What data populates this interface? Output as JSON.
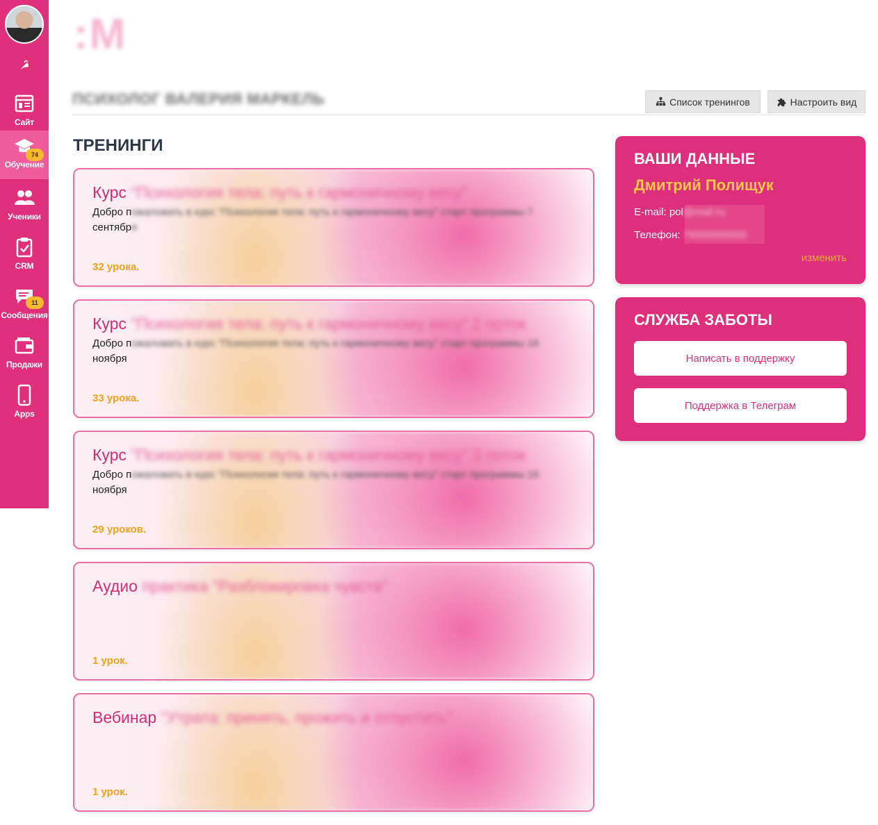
{
  "logo": ":M",
  "school_name": "ПСИХОЛОГ ВАЛЕРИЯ МАРКЕЛЬ",
  "sidebar": {
    "items": [
      {
        "label": "Сайт",
        "icon": "site-icon"
      },
      {
        "label": "Обучение",
        "icon": "graduation-cap-icon",
        "badge": "74"
      },
      {
        "label": "Ученики",
        "icon": "students-icon"
      },
      {
        "label": "CRM",
        "icon": "clipboard-check-icon"
      },
      {
        "label": "Сообщения",
        "icon": "chat-icon",
        "badge": "11"
      },
      {
        "label": "Продажи",
        "icon": "wallet-icon"
      },
      {
        "label": "Apps",
        "icon": "phone-icon"
      }
    ]
  },
  "toolbar": {
    "trainings_list_label": "Список тренингов",
    "customize_label": "Настроить вид"
  },
  "trainings": {
    "title": "ТРЕНИНГИ",
    "cards": [
      {
        "type": "Курс",
        "name": "\"Психология тела: путь к гармоничному весу\"",
        "desc_visible": "Добро п",
        "desc_blur": "ожаловать в курс \"Психология тела: путь к гармоничному весу\" старт программы 7",
        "desc_line2_visible": "сентябр",
        "desc_line2_blur": "я",
        "lessons": "32 урока."
      },
      {
        "type": "Курс",
        "name": "\"Психология тела: путь к гармоничному весу\" 2 поток",
        "desc_visible": "Добро п",
        "desc_blur": "ожаловать в курс \"Психология тела: путь к гармоничному весу\" старт программы 16",
        "desc_line2_visible": "ноября",
        "desc_line2_blur": "",
        "lessons": "33 урока."
      },
      {
        "type": "Курс",
        "name": "\"Психология тела: путь к гармоничному весу\" 3 поток",
        "desc_visible": "Добро п",
        "desc_blur": "ожаловать в курс \"Психология тела: путь к гармоничному весу\" старт программы 16",
        "desc_line2_visible": "ноября",
        "desc_line2_blur": "",
        "lessons": "29 уроков."
      },
      {
        "type": "Аудио",
        "name": "практика \"Разблокировка чувств\"",
        "desc_visible": "",
        "desc_blur": "",
        "desc_line2_visible": "",
        "desc_line2_blur": "",
        "lessons": "1 урок."
      },
      {
        "type": "Вебинар",
        "name": "\"Утрата: принять, прожить и отпустить\"",
        "desc_visible": "",
        "desc_blur": "",
        "desc_line2_visible": "",
        "desc_line2_blur": "",
        "lessons": "1 урок."
      }
    ]
  },
  "profile": {
    "title": "ВАШИ ДАННЫЕ",
    "name": "Дмитрий Полищук",
    "email_label": "E-mail: pol",
    "email_hidden": "@mail.ru",
    "phone_label": "Телефон: ",
    "phone_hidden": "79000000000",
    "edit_label": "изменить"
  },
  "support": {
    "title": "СЛУЖБА ЗАБОТЫ",
    "write_label": "Написать в поддержку",
    "telegram_label": "Поддержка в Телеграм"
  },
  "colors": {
    "brand_pink": "#e0307c",
    "accent_yellow": "#f6b92f",
    "lessons_orange": "#f3a21b"
  }
}
